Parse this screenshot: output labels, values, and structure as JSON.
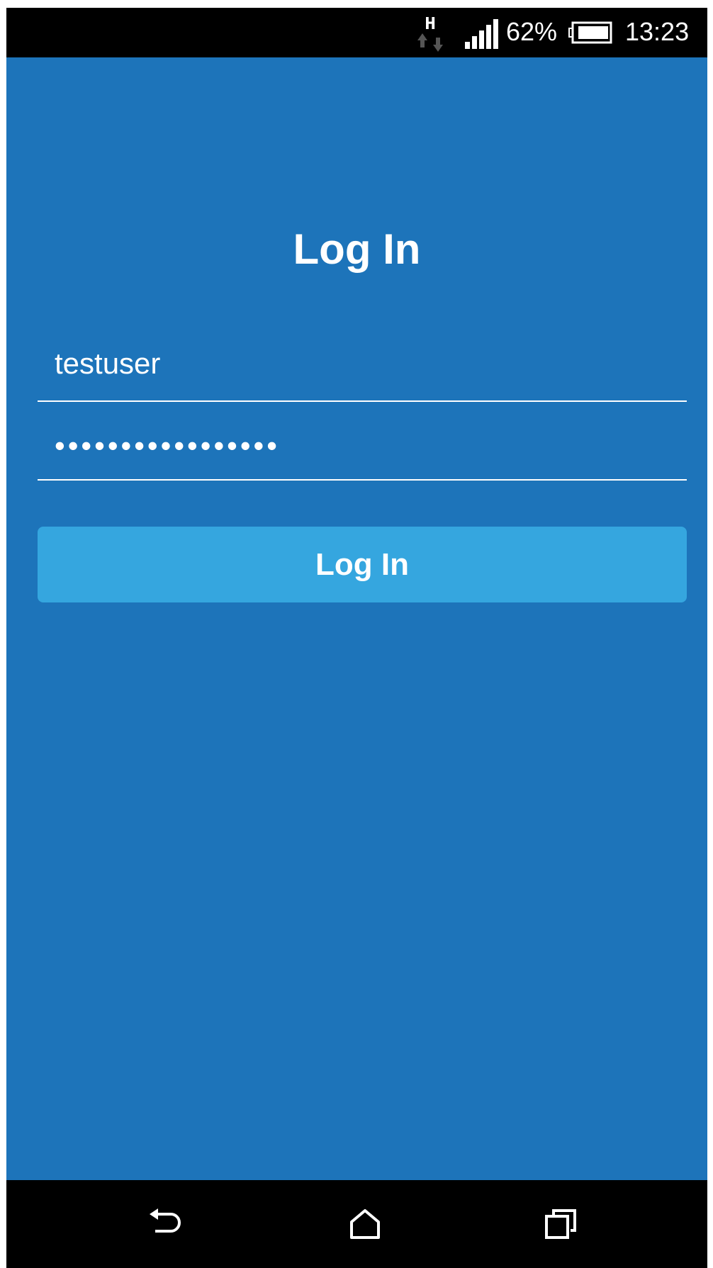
{
  "status_bar": {
    "network_type": "H",
    "battery_percent": "62%",
    "time": "13:23",
    "icons": [
      "network-activity-icon",
      "signal-strength-icon",
      "battery-icon"
    ]
  },
  "login": {
    "title": "Log In",
    "username_value": "testuser",
    "password_value": "•••••••••••••••••",
    "button_label": "Log In"
  },
  "nav_bar": {
    "icons": [
      "back-icon",
      "home-icon",
      "recents-icon"
    ]
  },
  "colors": {
    "background": "#1d74ba",
    "button": "#35a6df",
    "text": "#ffffff",
    "bars": "#000000"
  }
}
